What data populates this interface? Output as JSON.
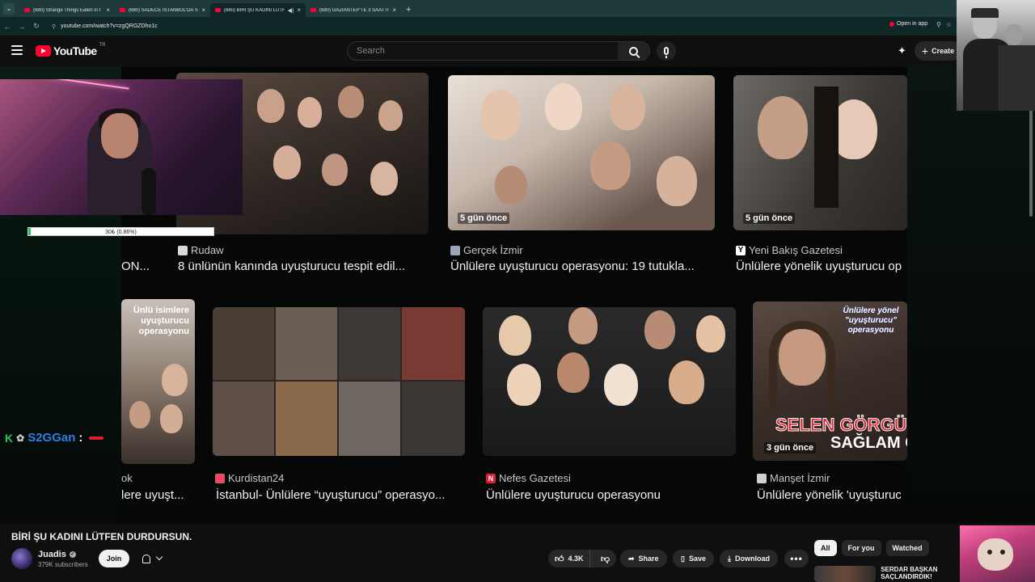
{
  "browser": {
    "tabs": [
      {
        "label": "(680) Strange Things Eaten in t",
        "active": false
      },
      {
        "label": "(680) SADECE İSTANBUL'DA YA",
        "active": false
      },
      {
        "label": "(680) BİRİ ŞU KADINI LÜTFE",
        "active": true
      },
      {
        "label": "(680) GAZİANTEP'TE 3 SAATTİ",
        "active": false
      }
    ],
    "new_tab": "+",
    "url": "youtube.com/watch?v=zgQRGZDho1c",
    "open_in_app": "Open in app"
  },
  "header": {
    "logo_text": "YouTube",
    "country_code": "TR",
    "search_placeholder": "Search",
    "create_label": "Create"
  },
  "video_content": {
    "row1": [
      {
        "ago": "",
        "channel": "Rudaw",
        "title": "8 ünlünün kanında uyuşturucu tespit edil...",
        "channel_color": "#d9d9d9"
      },
      {
        "ago": "5 gün önce",
        "channel": "Gerçek İzmir",
        "title": "Ünlülere uyuşturucu operasyonu: 19 tutukla...",
        "channel_color": "#9aa6b8"
      },
      {
        "ago": "5 gün önce",
        "channel": "Yeni Bakış Gazetesi",
        "title": "Ünlülere yönelik uyuşturucu op",
        "channel_color": "#ffffff",
        "channel_letter": "Y"
      }
    ],
    "row1_partial_left": "ON...",
    "row2": [
      {
        "channel": "",
        "title": "lere uyuşt...",
        "left_label": "ok",
        "overlay_text": "Ünlü isimlere uyuşturucu operasyonu"
      },
      {
        "channel": "Kurdistan24",
        "title": "İstanbul- Ünlülere “uyuşturucu” operasyo...",
        "channel_color": "#e94b6a"
      },
      {
        "channel": "Nefes Gazetesi",
        "title": "Ünlülere uyuşturucu operasyonu",
        "channel_color": "#e11d2e",
        "channel_letter": "N"
      },
      {
        "ago": "3 gün önce",
        "channel": "Manşet İzmir",
        "title": "Ünlülere yönelik 'uyuşturuc",
        "channel_color": "#cfcfcf",
        "overlay_top": "Ünlülere yönel \"uyuşturucu\" operasyonu",
        "overlay_big": "SELEN GÖRGÜ",
        "overlay_big2": "SAĞLAM GÖ"
      }
    ],
    "webcam_progress": {
      "text": "30₺ (0.86%)",
      "fraction": 0.0086
    },
    "chat": {
      "user": "S2GGan",
      "separator": ":"
    }
  },
  "below": {
    "title": "BİRİ ŞU KADINI LÜTFEN DURDURSUN.",
    "channel": "Juadis",
    "subscribers": "379K subscribers",
    "join": "Join",
    "likes": "4.3K",
    "share": "Share",
    "save": "Save",
    "download": "Download",
    "more": "•••",
    "chips": [
      "All",
      "For you",
      "Watched"
    ],
    "related_title": "SERDAR BAŞKAN SAÇLANDIRDIK!"
  },
  "icons": {
    "tab_close": "×",
    "speaker": "🔊",
    "cast": "⟐"
  }
}
